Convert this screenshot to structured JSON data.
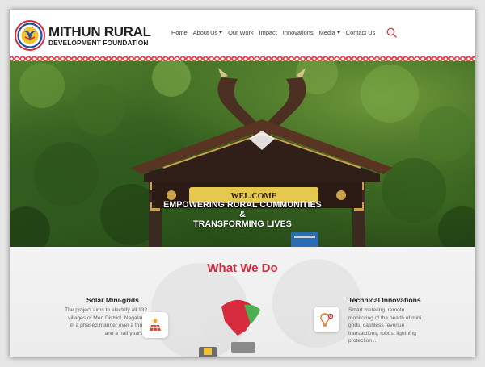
{
  "brand": {
    "line1": "MITHUN RURAL",
    "line2": "DEVELOPMENT FOUNDATION"
  },
  "nav": {
    "items": [
      {
        "label": "Home"
      },
      {
        "label": "About Us",
        "dropdown": true
      },
      {
        "label": "Our Work"
      },
      {
        "label": "Impact"
      },
      {
        "label": "Innovations"
      },
      {
        "label": "Media",
        "dropdown": true
      },
      {
        "label": "Contact Us"
      }
    ],
    "search_icon": "search-icon"
  },
  "hero": {
    "line1": "EMPOWERING RURAL COMMUNITIES",
    "line2": "&",
    "line3": "TRANSFORMING LIVES",
    "gate_sign": "WEL.COME"
  },
  "what_we_do": {
    "title": "What We Do",
    "left": {
      "title": "Solar Mini-grids",
      "desc_lines": [
        "The project aims to electrify all 132",
        "villages of Mon District, Nagaland",
        "in a phased manner over a three",
        "and a half years..."
      ],
      "icon": "solar-panel-icon"
    },
    "right": {
      "title": "Technical Innovations",
      "desc_lines": [
        "Smart metering, remote",
        "monitoring of the health of mini",
        "grids, cashless revenue",
        "transactions, robust lightning",
        "protection ..."
      ],
      "icon": "lightbulb-gear-icon"
    }
  },
  "colors": {
    "accent_red": "#d62b3d",
    "nav_text": "#3a3a3a",
    "search": "#e0363c"
  }
}
